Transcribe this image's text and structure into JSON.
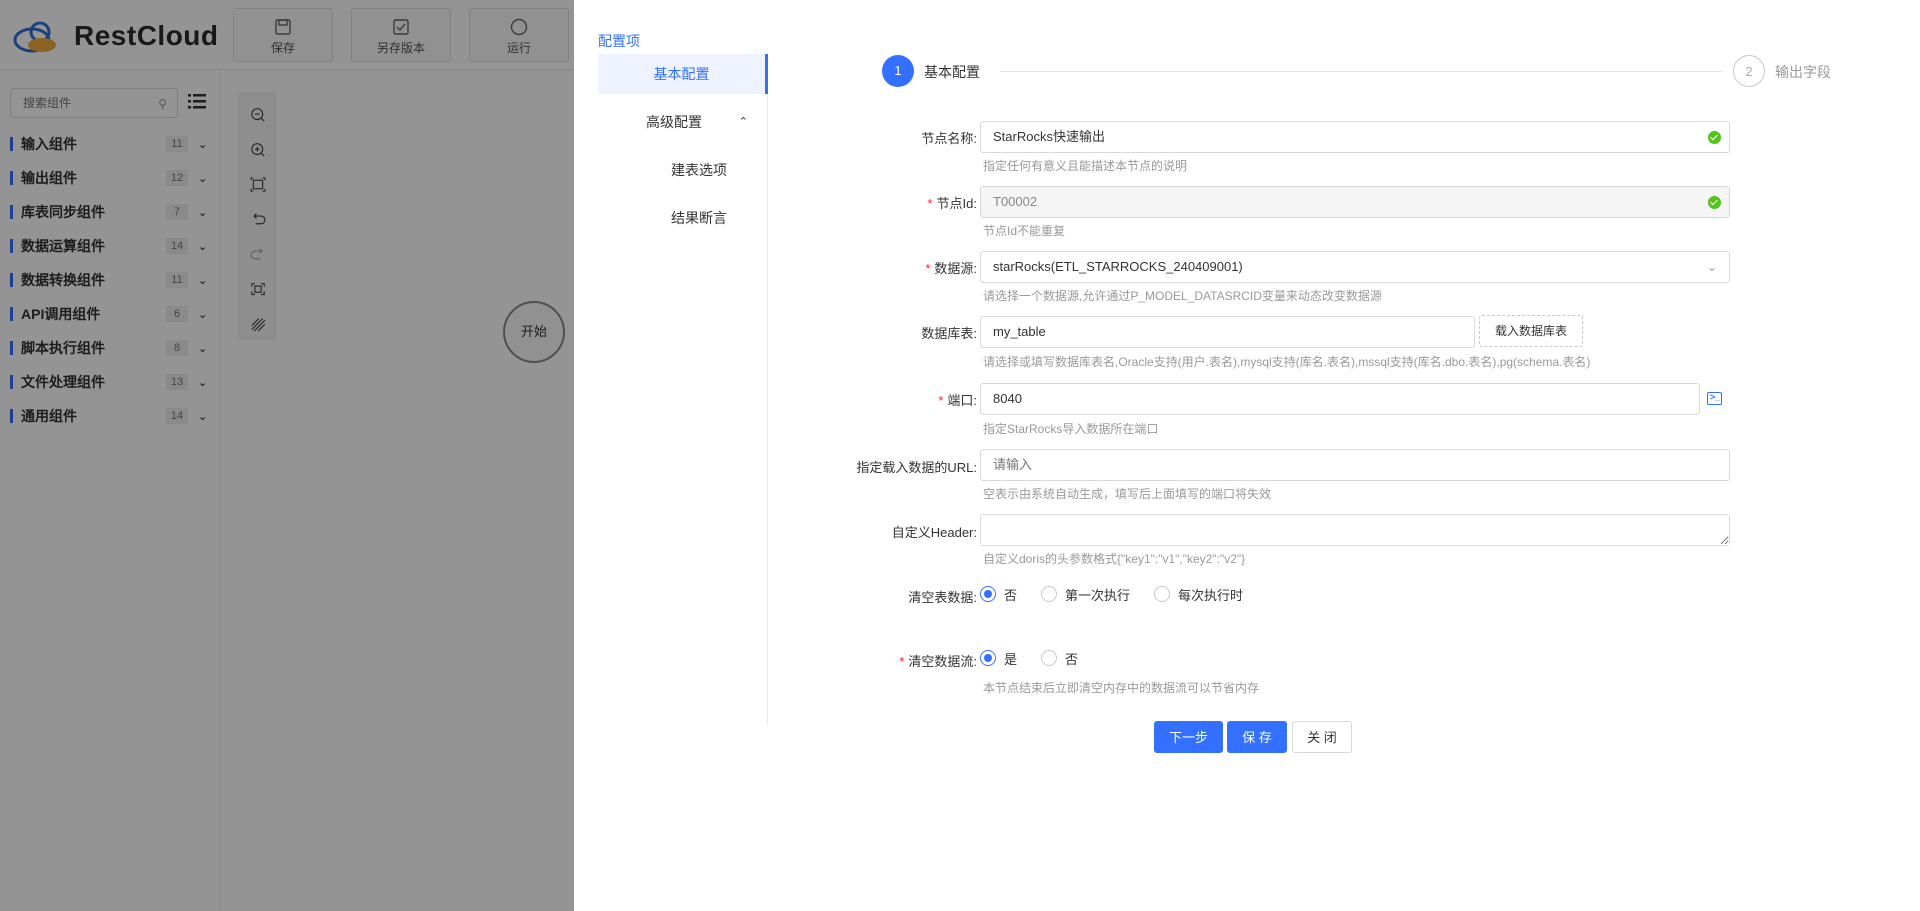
{
  "app": {
    "logo_text": "RestCloud",
    "toolbar": [
      {
        "label": "保存",
        "icon": "save-icon"
      },
      {
        "label": "另存版本",
        "icon": "save-version-icon"
      },
      {
        "label": "运行",
        "icon": "run-icon"
      }
    ],
    "search_placeholder": "搜索组件",
    "categories": [
      {
        "name": "输入组件",
        "count": "11"
      },
      {
        "name": "输出组件",
        "count": "12"
      },
      {
        "name": "库表同步组件",
        "count": "7"
      },
      {
        "name": "数据运算组件",
        "count": "14"
      },
      {
        "name": "数据转换组件",
        "count": "11"
      },
      {
        "name": "API调用组件",
        "count": "6"
      },
      {
        "name": "脚本执行组件",
        "count": "8"
      },
      {
        "name": "文件处理组件",
        "count": "13"
      },
      {
        "name": "通用组件",
        "count": "14"
      }
    ],
    "canvas_tools": [
      "zoom-out-icon",
      "zoom-in-icon",
      "fit-screen-icon",
      "undo-icon",
      "redo-icon",
      "fullscreen-icon",
      "grid-icon"
    ],
    "start_node_label": "开始"
  },
  "drawer": {
    "config_title": "配置项",
    "nav": {
      "basic": "基本配置",
      "advanced": "高级配置",
      "create_table": "建表选项",
      "result_assert": "结果断言"
    },
    "steps": [
      {
        "number": "1",
        "label": "基本配置"
      },
      {
        "number": "2",
        "label": "输出字段"
      }
    ],
    "form": {
      "node_name": {
        "label": "节点名称:",
        "value": "StarRocks快速输出",
        "hint": "指定任何有意义且能描述本节点的说明"
      },
      "node_id": {
        "label": "节点Id:",
        "value": "T00002",
        "hint": "节点Id不能重复"
      },
      "datasource": {
        "label": "数据源:",
        "value": "starRocks(ETL_STARROCKS_240409001)",
        "hint": "请选择一个数据源,允许通过P_MODEL_DATASRCID变量来动态改变数据源"
      },
      "table": {
        "label": "数据库表:",
        "value": "my_table",
        "button": "载入数据库表",
        "hint": "请选择或填写数据库表名,Oracle支持(用户.表名),mysql支持(库名.表名),mssql支持(库名.dbo.表名),pg(schema.表名)"
      },
      "port": {
        "label": "端口:",
        "value": "8040",
        "hint": "指定StarRocks导入数据所在端口"
      },
      "url": {
        "label": "指定载入数据的URL:",
        "placeholder": "请输入",
        "hint": "空表示由系统自动生成，填写后上面填写的端口将失效"
      },
      "header": {
        "label": "自定义Header:",
        "value": "",
        "hint": "自定义doris的头参数格式{\"key1\":\"v1\",\"key2\":\"v2\"}"
      },
      "clear_table": {
        "label": "清空表数据:",
        "options": [
          "否",
          "第一次执行",
          "每次执行时"
        ],
        "selected": "否"
      },
      "clear_stream": {
        "label": "清空数据流:",
        "options": [
          "是",
          "否"
        ],
        "selected": "是",
        "hint": "本节点结束后立即清空内存中的数据流可以节省内存"
      }
    },
    "buttons": {
      "next": "下一步",
      "save": "保 存",
      "close": "关 闭"
    }
  },
  "colors": {
    "accent": "#3370ff",
    "success": "#52c41a",
    "required": "#f5222d"
  }
}
